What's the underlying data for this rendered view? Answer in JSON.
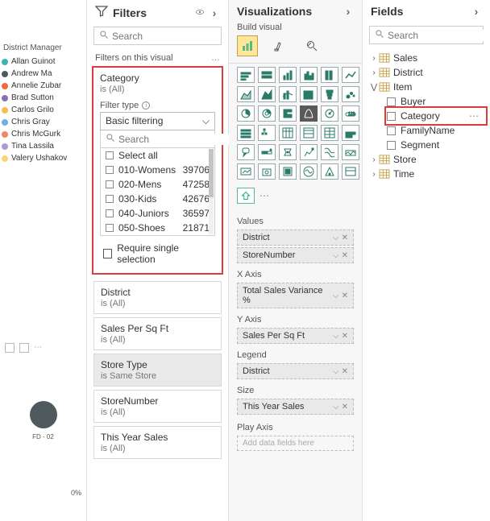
{
  "canvas": {
    "legend_title": "District Manager",
    "managers": [
      {
        "name": "Allan Guinot",
        "color": "#39b5b1"
      },
      {
        "name": "Andrew Ma",
        "color": "#4f5a5f"
      },
      {
        "name": "Annelie Zubar",
        "color": "#f06a3a"
      },
      {
        "name": "Brad Sutton",
        "color": "#8b6fb0"
      },
      {
        "name": "Carlos Grilo",
        "color": "#f4c04d"
      },
      {
        "name": "Chris Gray",
        "color": "#6fb0df"
      },
      {
        "name": "Chris McGurk",
        "color": "#f0866a"
      },
      {
        "name": "Tina Lassila",
        "color": "#b09bd0"
      },
      {
        "name": "Valery Ushakov",
        "color": "#f5d77a"
      }
    ],
    "bubble_label": "FD - 02",
    "pct": "0%"
  },
  "filters": {
    "pane_title": "Filters",
    "search_placeholder": "Search",
    "section_label": "Filters on this visual",
    "category_card": {
      "title": "Category",
      "sub": "is (All)",
      "filter_type_label": "Filter type",
      "filter_type_value": "Basic filtering",
      "search_placeholder": "Search",
      "values": [
        {
          "label": "Select all",
          "count": ""
        },
        {
          "label": "010-Womens",
          "count": "39706"
        },
        {
          "label": "020-Mens",
          "count": "47258"
        },
        {
          "label": "030-Kids",
          "count": "42676"
        },
        {
          "label": "040-Juniors",
          "count": "36597"
        },
        {
          "label": "050-Shoes",
          "count": "21871"
        }
      ],
      "require_single": "Require single selection"
    },
    "other_cards": [
      {
        "title": "District",
        "sub": "is (All)"
      },
      {
        "title": "Sales Per Sq Ft",
        "sub": "is (All)"
      },
      {
        "title": "Store Type",
        "sub": "is Same Store",
        "gray": true
      },
      {
        "title": "StoreNumber",
        "sub": "is (All)"
      },
      {
        "title": "This Year Sales",
        "sub": "is (All)"
      }
    ]
  },
  "viz": {
    "pane_title": "Visualizations",
    "build_label": "Build visual",
    "wells": [
      {
        "label": "Values",
        "items": [
          "District",
          "StoreNumber"
        ]
      },
      {
        "label": "X Axis",
        "items": [
          "Total Sales Variance %"
        ]
      },
      {
        "label": "Y Axis",
        "items": [
          "Sales Per Sq Ft"
        ]
      },
      {
        "label": "Legend",
        "items": [
          "District"
        ]
      },
      {
        "label": "Size",
        "items": [
          "This Year Sales"
        ]
      }
    ],
    "play_axis_label": "Play Axis",
    "add_hint": "Add data fields here"
  },
  "fields": {
    "pane_title": "Fields",
    "search_placeholder": "Search",
    "tables": [
      {
        "name": "Sales",
        "expanded": false
      },
      {
        "name": "District",
        "expanded": false
      },
      {
        "name": "Item",
        "expanded": true,
        "fields": [
          {
            "name": "Buyer",
            "highlight": false
          },
          {
            "name": "Category",
            "highlight": true
          },
          {
            "name": "FamilyName",
            "highlight": false
          },
          {
            "name": "Segment",
            "highlight": false
          }
        ]
      },
      {
        "name": "Store",
        "expanded": false
      },
      {
        "name": "Time",
        "expanded": false
      }
    ]
  }
}
